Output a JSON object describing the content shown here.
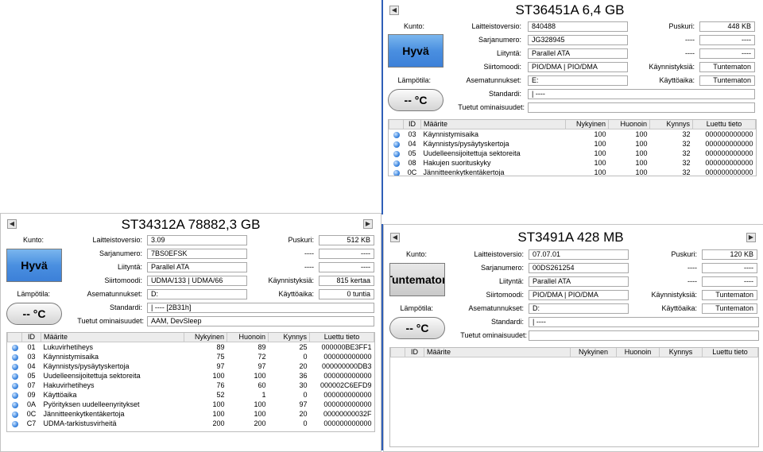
{
  "labels": {
    "health": "Kunto:",
    "temperature": "Lämpötila:",
    "firmware": "Laitteistoversio:",
    "serial": "Sarjanumero:",
    "interface": "Liityntä:",
    "transfer": "Siirtomoodi:",
    "drive_letter": "Asematunnukset:",
    "standard": "Standardi:",
    "features": "Tuetut ominaisuudet:",
    "buffer": "Puskuri:",
    "power_on_count": "Käynnistyksiä:",
    "power_on_hours": "Käyttöaika:"
  },
  "columns": [
    "",
    "ID",
    "Määrite",
    "Nykyinen",
    "Huonoin",
    "Kynnys",
    "Luettu tieto"
  ],
  "colors": {
    "status_good": "#4a8fe0",
    "status_unknown": "#c9c9c9",
    "divider": "#2f5fb8"
  },
  "icons": {
    "prev": "◀",
    "next": "▶",
    "status": "blue-dot-icon"
  },
  "drives": {
    "d1": {
      "title": "ST36451A 6,4 GB",
      "health": "Hyvä",
      "temperature": "-- °C",
      "firmware": "840488",
      "serial": "JG328945",
      "interface": "Parallel ATA",
      "transfer": "PIO/DMA | PIO/DMA",
      "drive_letter": "E:",
      "standard": "| ----",
      "features": "",
      "buffer": "448 KB",
      "dash_label_1": "----",
      "dash_value_1": "----",
      "dash_label_2": "----",
      "dash_value_2": "----",
      "power_on_count": "Tuntematon",
      "power_on_hours": "Tuntematon",
      "rows": [
        {
          "id": "03",
          "name": "Käynnistymisaika",
          "current": "100",
          "worst": "100",
          "threshold": "32",
          "raw": "000000000000"
        },
        {
          "id": "04",
          "name": "Käynnistys/pysäytyskertoja",
          "current": "100",
          "worst": "100",
          "threshold": "32",
          "raw": "000000000000"
        },
        {
          "id": "05",
          "name": "Uudelleensijoitettuja sektoreita",
          "current": "100",
          "worst": "100",
          "threshold": "32",
          "raw": "000000000000"
        },
        {
          "id": "08",
          "name": "Hakujen suorituskyky",
          "current": "100",
          "worst": "100",
          "threshold": "32",
          "raw": "000000000000"
        },
        {
          "id": "0C",
          "name": "Jännitteenkytkentäkertoja",
          "current": "100",
          "worst": "100",
          "threshold": "32",
          "raw": "000000000000"
        }
      ]
    },
    "d2": {
      "title": "ST34312A 78882,3 GB",
      "health": "Hyvä",
      "temperature": "-- °C",
      "firmware": "3.09",
      "serial": "7BS0EFSK",
      "interface": "Parallel ATA",
      "transfer": "UDMA/133 | UDMA/66",
      "drive_letter": "D:",
      "standard": "| ---- [2B31h]",
      "features": "AAM, DevSleep",
      "buffer": "512 KB",
      "dash_label_1": "----",
      "dash_value_1": "----",
      "dash_label_2": "----",
      "dash_value_2": "----",
      "power_on_count": "815 kertaa",
      "power_on_hours": "0 tuntia",
      "rows": [
        {
          "id": "01",
          "name": "Lukuvirhetiheys",
          "current": "89",
          "worst": "89",
          "threshold": "25",
          "raw": "000000BE3FF1"
        },
        {
          "id": "03",
          "name": "Käynnistymisaika",
          "current": "75",
          "worst": "72",
          "threshold": "0",
          "raw": "000000000000"
        },
        {
          "id": "04",
          "name": "Käynnistys/pysäytyskertoja",
          "current": "97",
          "worst": "97",
          "threshold": "20",
          "raw": "000000000DB3"
        },
        {
          "id": "05",
          "name": "Uudelleensijoitettuja sektoreita",
          "current": "100",
          "worst": "100",
          "threshold": "36",
          "raw": "000000000000"
        },
        {
          "id": "07",
          "name": "Hakuvirhetiheys",
          "current": "76",
          "worst": "60",
          "threshold": "30",
          "raw": "000002C6EFD9"
        },
        {
          "id": "09",
          "name": "Käyttöaika",
          "current": "52",
          "worst": "1",
          "threshold": "0",
          "raw": "000000000000"
        },
        {
          "id": "0A",
          "name": "Pyörityksen uudelleenyritykset",
          "current": "100",
          "worst": "100",
          "threshold": "97",
          "raw": "000000000000"
        },
        {
          "id": "0C",
          "name": "Jännitteenkytkentäkertoja",
          "current": "100",
          "worst": "100",
          "threshold": "20",
          "raw": "00000000032F"
        },
        {
          "id": "C7",
          "name": "UDMA-tarkistusvirheitä",
          "current": "200",
          "worst": "200",
          "threshold": "0",
          "raw": "000000000000"
        }
      ]
    },
    "d3": {
      "title": "ST3491A 428 MB",
      "health": "Tuntematon",
      "temperature": "-- °C",
      "firmware": "07.07.01",
      "serial": "00DS261254",
      "interface": "Parallel ATA",
      "transfer": "PIO/DMA | PIO/DMA",
      "drive_letter": "D:",
      "standard": "| ----",
      "features": "",
      "buffer": "120 KB",
      "dash_label_1": "----",
      "dash_value_1": "----",
      "dash_label_2": "----",
      "dash_value_2": "----",
      "power_on_count": "Tuntematon",
      "power_on_hours": "Tuntematon",
      "rows": []
    }
  }
}
